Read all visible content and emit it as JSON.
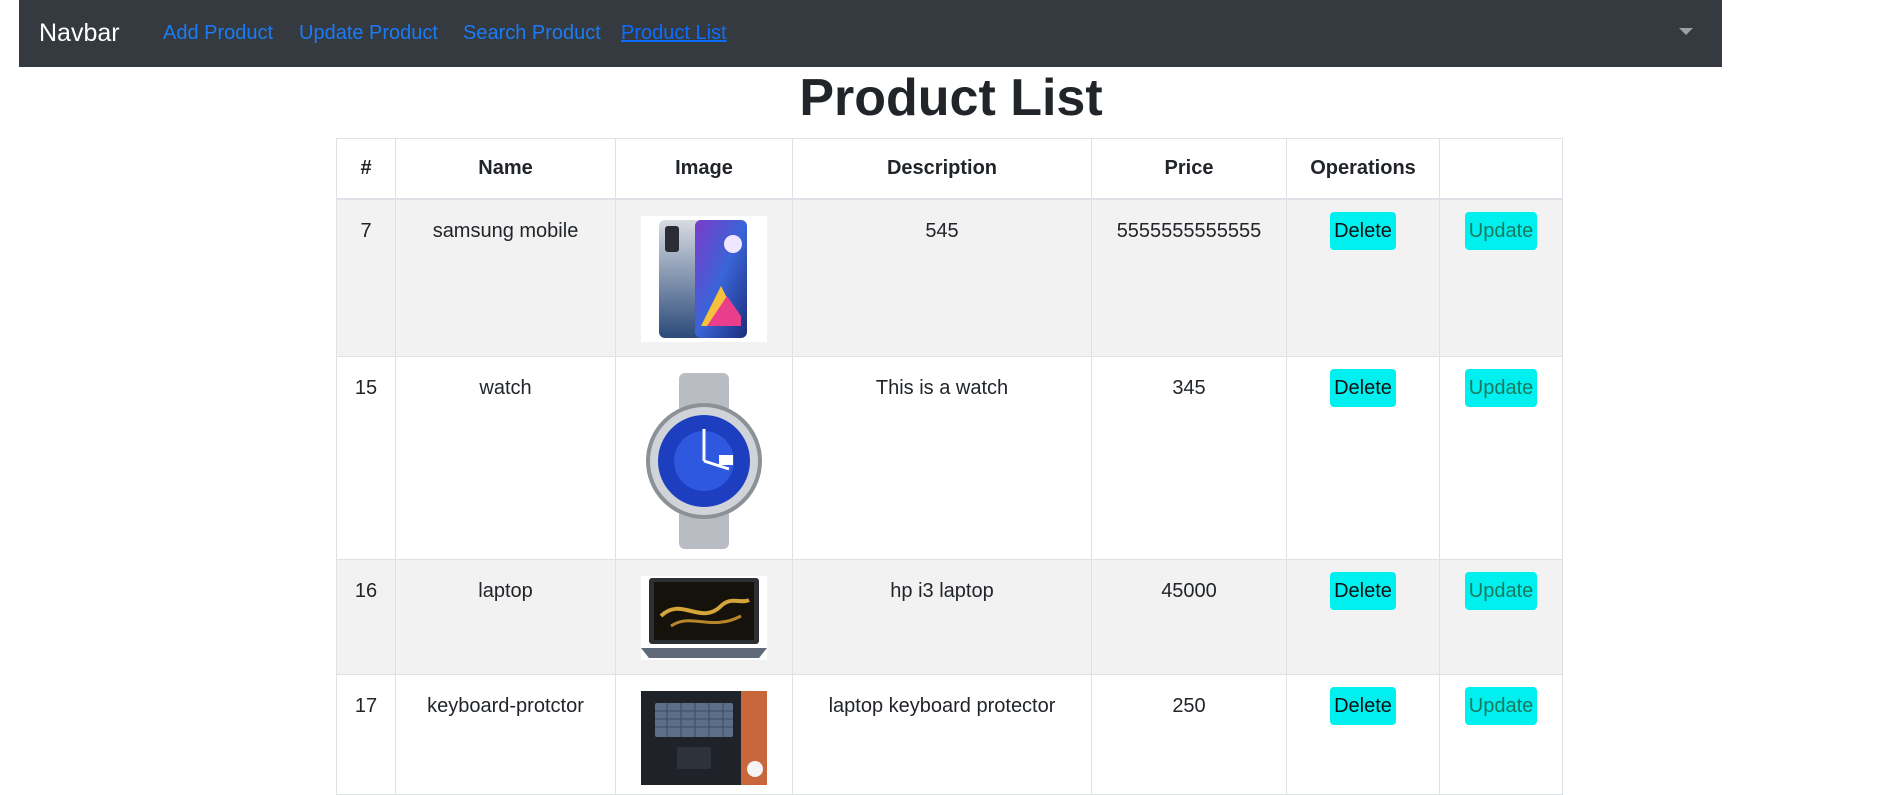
{
  "navbar": {
    "brand": "Navbar",
    "links": [
      "Add Product",
      "Update Product",
      "Search Product",
      "Product List"
    ],
    "active": "Product List",
    "dropdown_icon": "caret-down-icon"
  },
  "page": {
    "title": "Product List"
  },
  "table": {
    "headers": [
      "#",
      "Name",
      "Image",
      "Description",
      "Price",
      "Operations",
      ""
    ],
    "rows": [
      {
        "id": "7",
        "name": "samsung mobile",
        "image": "phone-image",
        "description": "545",
        "price": "5555555555555",
        "delete_label": "Delete",
        "update_label": "Update"
      },
      {
        "id": "15",
        "name": "watch",
        "image": "watch-image",
        "description": "This is a watch",
        "price": "345",
        "delete_label": "Delete",
        "update_label": "Update"
      },
      {
        "id": "16",
        "name": "laptop",
        "image": "laptop-image",
        "description": "hp i3 laptop",
        "price": "45000",
        "delete_label": "Delete",
        "update_label": "Update"
      },
      {
        "id": "17",
        "name": "keyboard-protctor",
        "image": "keyboard-image",
        "description": "laptop keyboard protector",
        "price": "250",
        "delete_label": "Delete",
        "update_label": "Update"
      }
    ]
  },
  "colors": {
    "navbar_bg": "#343a40",
    "link": "#0d6efd",
    "button_bg": "#00f0f0",
    "stripe": "#f2f2f2"
  }
}
